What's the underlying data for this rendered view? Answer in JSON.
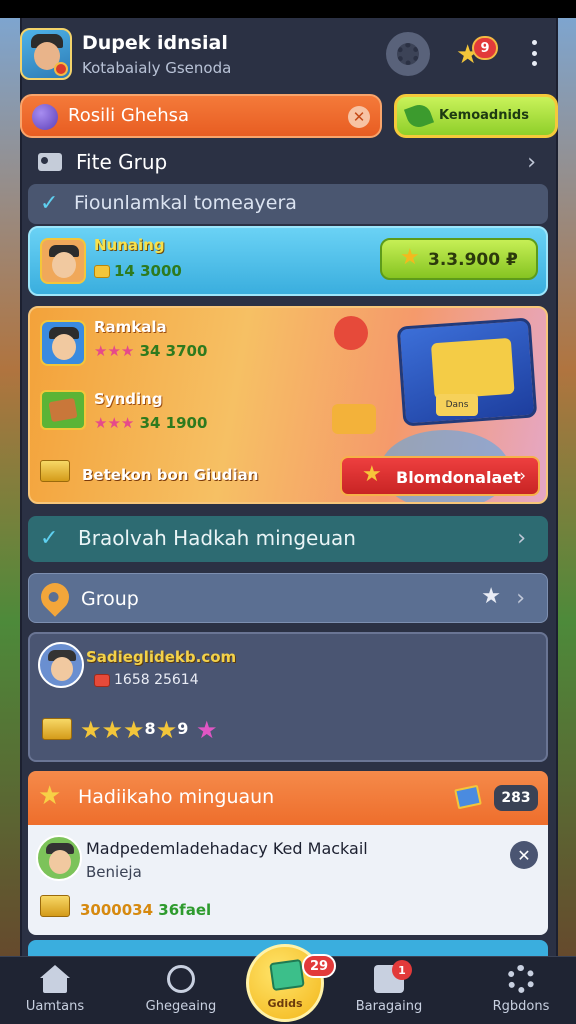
{
  "header": {
    "title": "Dupek idnsial",
    "subtitle": "Kotabaialy Gsenoda",
    "notification_count": "9"
  },
  "search": {
    "text": "Rosili Ghehsa",
    "promo_label": "Kemoadnids"
  },
  "rows": {
    "file_group": "Fite Grup",
    "section_1": "Fiounlamkal tomeayera"
  },
  "blue_card": {
    "name": "Nunaing",
    "stats": "14 3000",
    "price": "3.3.900 ₽"
  },
  "feature_card": {
    "player_1_name": "Ramkala",
    "player_1_stats": "34 3700",
    "player_2_name": "Synding",
    "player_2_stats": "34 1900",
    "footer_text": "Betekon bon Giudian",
    "button_label": "Blomdonalaet",
    "sign": "Dans"
  },
  "teal_bar": {
    "title": "Braolvah Hadkah mingeuan"
  },
  "group_bar": {
    "title": "Group"
  },
  "player_card": {
    "name": "Sadieglidekb.com",
    "stats": "1658 25614",
    "rating_number": "8",
    "rating_tail": "9"
  },
  "weekly": {
    "title": "Hadiikaho minguaun",
    "count": "283"
  },
  "message": {
    "title": "Madpedemladehadacy Ked Mackail",
    "subtitle": "Benieja",
    "amount_gold": "3000034",
    "amount_green": "36fael"
  },
  "bottom_nav": {
    "home": "Uamtans",
    "social": "Ghegeaing",
    "center": "Gdids",
    "center_badge": "29",
    "gift": "Baragaing",
    "gift_badge": "1",
    "settings": "Rgbdons"
  },
  "colors": {
    "panel": "#2b3144",
    "accent_orange": "#ee6e2c",
    "accent_green": "#86c422",
    "accent_red": "#e23a3a",
    "accent_teal": "#2d6b72"
  },
  "icons": [
    "avatar",
    "gear-icon",
    "star-icon",
    "more-icon",
    "orb-icon",
    "close-icon",
    "leaf-icon",
    "folder-icon",
    "chevron-right-icon",
    "check-icon",
    "coin-icon",
    "pin-icon",
    "book-icon",
    "home-icon",
    "gift-icon",
    "cog-icon"
  ]
}
